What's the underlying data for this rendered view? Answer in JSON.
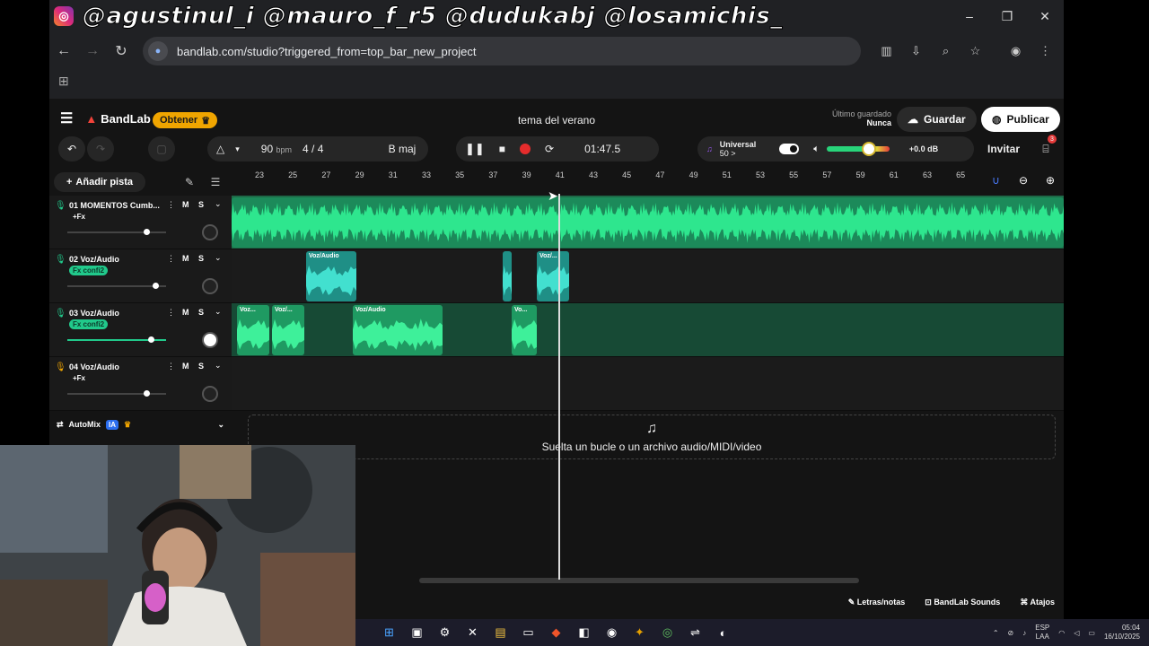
{
  "overlay": {
    "handles": "@agustinul_i @mauro_f_r5 @dudukabj @losamichis_"
  },
  "browser": {
    "url": "bandlab.com/studio?triggered_from=top_bar_new_project",
    "window_controls": [
      "–",
      "❐",
      "✕"
    ]
  },
  "app": {
    "brand": "BandLab",
    "get_label": "Obtener",
    "project_title": "tema del verano",
    "last_saved_label": "Último guardado",
    "last_saved_value": "Nunca",
    "save_label": "Guardar",
    "publish_label": "Publicar"
  },
  "transport": {
    "bpm": "90",
    "bpm_unit": "bpm",
    "time_sig_num": "4",
    "time_sig_den": "4",
    "key": "B maj",
    "time": "01:47.5",
    "preset_name": "Universal",
    "preset_count": "50 >",
    "volume_level": 0.67,
    "gain": "+0.0 dB",
    "invite_label": "Invitar",
    "notifications": "3"
  },
  "timeline": {
    "add_track_label": "Añadir pista",
    "bars": [
      "23",
      "25",
      "27",
      "29",
      "31",
      "33",
      "35",
      "37",
      "39",
      "41",
      "43",
      "45",
      "47",
      "49",
      "51",
      "53",
      "55",
      "57",
      "59",
      "61",
      "63",
      "65"
    ],
    "drop_text": "Suelta un bucle o un archivo audio/MIDI/video"
  },
  "tracks": [
    {
      "name": "01 MOMENTOS Cumb...",
      "fx": "+Fx",
      "mute": "M",
      "solo": "S",
      "volume": 0.85,
      "clips": []
    },
    {
      "name": "02 Voz/Audio",
      "fx": "Fx confi2",
      "mute": "M",
      "solo": "S",
      "volume": 0.95,
      "clips": [
        {
          "label": "Voz/Audio"
        },
        {
          "label": ""
        },
        {
          "label": "Voz/..."
        }
      ]
    },
    {
      "name": "03 Voz/Audio",
      "fx": "Fx confi2",
      "mute": "M",
      "solo": "S",
      "volume": 0.9,
      "clips": [
        {
          "label": "Voz..."
        },
        {
          "label": "Voz/..."
        },
        {
          "label": "Voz/Audio"
        },
        {
          "label": "Vo..."
        }
      ]
    },
    {
      "name": "04 Voz/Audio",
      "fx": "+Fx",
      "mute": "M",
      "solo": "S",
      "volume": 0.85,
      "clips": []
    }
  ],
  "automix": {
    "label": "AutoMix",
    "badge": "IA"
  },
  "footer": {
    "lyrics": "Letras/notas",
    "sounds": "BandLab Sounds",
    "shortcuts": "Atajos"
  },
  "taskbar": {
    "lang1": "ESP",
    "lang2": "LAA",
    "time": "05:04",
    "date": "16/10/2025"
  },
  "colors": {
    "accent_green": "#1fd47a",
    "clip_teal": "#2bb7a8",
    "record_red": "#e52c2c",
    "brand_red": "#f2433a"
  }
}
